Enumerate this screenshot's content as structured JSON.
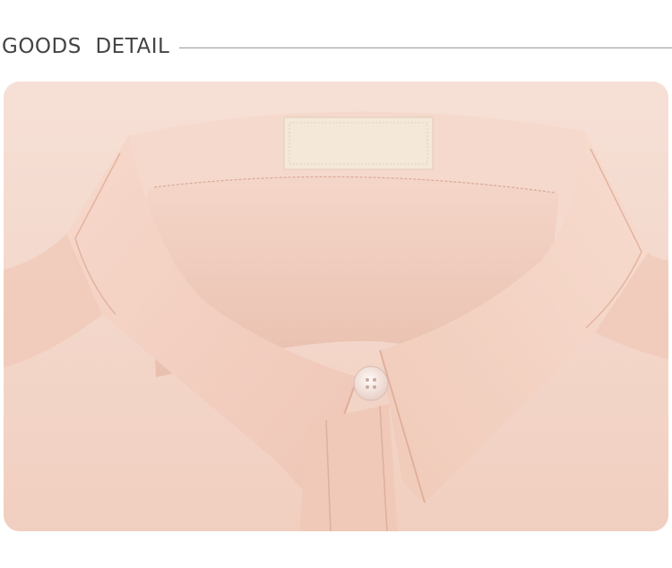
{
  "header": {
    "title": "GOODS  DETAIL"
  },
  "product_image": {
    "subject": "pink-shirt-collar-closeup",
    "colors": {
      "fabric": "#f3d2c4",
      "fabric_shadow": "#e2b3a3",
      "label": "#f4e6d4",
      "button": "#f7eae6"
    }
  }
}
